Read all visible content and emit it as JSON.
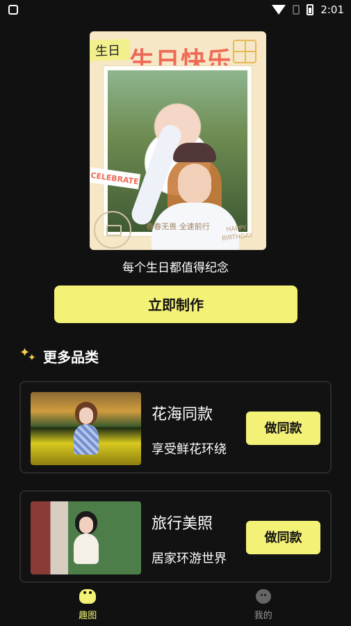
{
  "status_bar": {
    "time": "2:01"
  },
  "hero": {
    "badge": "生日",
    "title": "生日快乐",
    "celebrate_tag": "CELEBRATE",
    "motto": "春春无畏 全速前行",
    "happy_birthday": "HAPPY BIRTHDAY",
    "caption": "每个生日都值得纪念",
    "button": "立即制作"
  },
  "section": {
    "title": "更多品类"
  },
  "categories": [
    {
      "title": "花海同款",
      "subtitle": "享受鲜花环绕",
      "button": "做同款"
    },
    {
      "title": "旅行美照",
      "subtitle": "居家环游世界",
      "button": "做同款"
    }
  ],
  "bottom_nav": {
    "items": [
      {
        "label": "趣图",
        "icon": "smile-icon",
        "active": true
      },
      {
        "label": "我的",
        "icon": "face-icon",
        "active": false
      }
    ]
  }
}
